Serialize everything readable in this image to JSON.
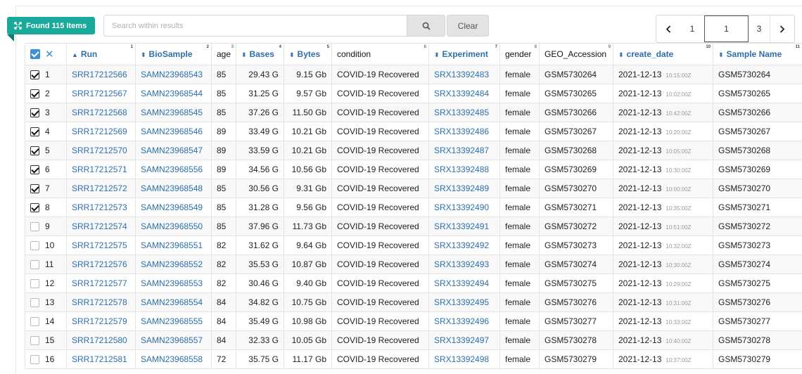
{
  "toolbar": {
    "found_label": "Found 115 Items",
    "search_placeholder": "Search within results",
    "search_value": "",
    "clear_label": "Clear"
  },
  "pager": {
    "pages": [
      "1",
      "1",
      "3"
    ],
    "prev_icon": "chevron-left-icon",
    "next_icon": "chevron-right-icon"
  },
  "columns": [
    {
      "label": "",
      "num": "",
      "sortable": false
    },
    {
      "label": "Run",
      "num": "1",
      "sortable": true,
      "sort": "asc"
    },
    {
      "label": "BioSample",
      "num": "2",
      "sortable": true
    },
    {
      "label": "age",
      "num": "3",
      "sortable": false
    },
    {
      "label": "Bases",
      "num": "4",
      "sortable": true
    },
    {
      "label": "Bytes",
      "num": "5",
      "sortable": true
    },
    {
      "label": "condition",
      "num": "6",
      "sortable": false
    },
    {
      "label": "Experiment",
      "num": "7",
      "sortable": true
    },
    {
      "label": "gender",
      "num": "8",
      "sortable": false
    },
    {
      "label": "GEO_Accession",
      "num": "9",
      "sortable": false
    },
    {
      "label": "create_date",
      "num": "10",
      "sortable": true
    },
    {
      "label": "Sample Name",
      "num": "11",
      "sortable": true
    }
  ],
  "rows": [
    {
      "checked": true,
      "n": "1",
      "run": "SRR17212566",
      "biosample": "SAMN23968543",
      "age": "85",
      "bases": "29.43 G",
      "bytes": "9.15 Gb",
      "condition": "COVID-19 Recovered",
      "experiment": "SRX13392483",
      "gender": "female",
      "geo": "GSM5730264",
      "date": "2021-12-13",
      "time": "10:15:00Z",
      "sample": "GSM5730264"
    },
    {
      "checked": true,
      "n": "2",
      "run": "SRR17212567",
      "biosample": "SAMN23968544",
      "age": "85",
      "bases": "31.25 G",
      "bytes": "9.57 Gb",
      "condition": "COVID-19 Recovered",
      "experiment": "SRX13392484",
      "gender": "female",
      "geo": "GSM5730265",
      "date": "2021-12-13",
      "time": "10:02:00Z",
      "sample": "GSM5730265"
    },
    {
      "checked": true,
      "n": "3",
      "run": "SRR17212568",
      "biosample": "SAMN23968545",
      "age": "85",
      "bases": "37.26 G",
      "bytes": "11.50 Gb",
      "condition": "COVID-19 Recovered",
      "experiment": "SRX13392485",
      "gender": "female",
      "geo": "GSM5730266",
      "date": "2021-12-13",
      "time": "10:42:00Z",
      "sample": "GSM5730266"
    },
    {
      "checked": true,
      "n": "4",
      "run": "SRR17212569",
      "biosample": "SAMN23968546",
      "age": "89",
      "bases": "33.49 G",
      "bytes": "10.21 Gb",
      "condition": "COVID-19 Recovered",
      "experiment": "SRX13392486",
      "gender": "female",
      "geo": "GSM5730267",
      "date": "2021-12-13",
      "time": "10:20:00Z",
      "sample": "GSM5730267"
    },
    {
      "checked": true,
      "n": "5",
      "run": "SRR17212570",
      "biosample": "SAMN23968547",
      "age": "89",
      "bases": "33.59 G",
      "bytes": "10.21 Gb",
      "condition": "COVID-19 Recovered",
      "experiment": "SRX13392487",
      "gender": "female",
      "geo": "GSM5730268",
      "date": "2021-12-13",
      "time": "10:05:00Z",
      "sample": "GSM5730268"
    },
    {
      "checked": true,
      "n": "6",
      "run": "SRR17212571",
      "biosample": "SAMN23968556",
      "age": "89",
      "bases": "34.56 G",
      "bytes": "10.56 Gb",
      "condition": "COVID-19 Recovered",
      "experiment": "SRX13392488",
      "gender": "female",
      "geo": "GSM5730269",
      "date": "2021-12-13",
      "time": "10:30:00Z",
      "sample": "GSM5730269"
    },
    {
      "checked": true,
      "n": "7",
      "run": "SRR17212572",
      "biosample": "SAMN23968548",
      "age": "85",
      "bases": "30.56 G",
      "bytes": "9.31 Gb",
      "condition": "COVID-19 Recovered",
      "experiment": "SRX13392489",
      "gender": "female",
      "geo": "GSM5730270",
      "date": "2021-12-13",
      "time": "10:00:00Z",
      "sample": "GSM5730270"
    },
    {
      "checked": true,
      "n": "8",
      "run": "SRR17212573",
      "biosample": "SAMN23968549",
      "age": "85",
      "bases": "31.28 G",
      "bytes": "9.56 Gb",
      "condition": "COVID-19 Recovered",
      "experiment": "SRX13392490",
      "gender": "female",
      "geo": "GSM5730271",
      "date": "2021-12-13",
      "time": "10:35:00Z",
      "sample": "GSM5730271"
    },
    {
      "checked": false,
      "n": "9",
      "run": "SRR17212574",
      "biosample": "SAMN23968550",
      "age": "85",
      "bases": "37.96 G",
      "bytes": "11.73 Gb",
      "condition": "COVID-19 Recovered",
      "experiment": "SRX13392491",
      "gender": "female",
      "geo": "GSM5730272",
      "date": "2021-12-13",
      "time": "10:51:00Z",
      "sample": "GSM5730272"
    },
    {
      "checked": false,
      "n": "10",
      "run": "SRR17212575",
      "biosample": "SAMN23968551",
      "age": "82",
      "bases": "31.62 G",
      "bytes": "9.64 Gb",
      "condition": "COVID-19 Recovered",
      "experiment": "SRX13392492",
      "gender": "female",
      "geo": "GSM5730273",
      "date": "2021-12-13",
      "time": "10:32:00Z",
      "sample": "GSM5730273"
    },
    {
      "checked": false,
      "n": "11",
      "run": "SRR17212576",
      "biosample": "SAMN23968552",
      "age": "82",
      "bases": "35.53 G",
      "bytes": "10.87 Gb",
      "condition": "COVID-19 Recovered",
      "experiment": "SRX13392493",
      "gender": "female",
      "geo": "GSM5730274",
      "date": "2021-12-13",
      "time": "10:30:00Z",
      "sample": "GSM5730274"
    },
    {
      "checked": false,
      "n": "12",
      "run": "SRR17212577",
      "biosample": "SAMN23968553",
      "age": "82",
      "bases": "30.46 G",
      "bytes": "9.40 Gb",
      "condition": "COVID-19 Recovered",
      "experiment": "SRX13392494",
      "gender": "female",
      "geo": "GSM5730275",
      "date": "2021-12-13",
      "time": "10:29:00Z",
      "sample": "GSM5730275"
    },
    {
      "checked": false,
      "n": "13",
      "run": "SRR17212578",
      "biosample": "SAMN23968554",
      "age": "84",
      "bases": "34.82 G",
      "bytes": "10.75 Gb",
      "condition": "COVID-19 Recovered",
      "experiment": "SRX13392495",
      "gender": "female",
      "geo": "GSM5730276",
      "date": "2021-12-13",
      "time": "10:31:00Z",
      "sample": "GSM5730276"
    },
    {
      "checked": false,
      "n": "14",
      "run": "SRR17212579",
      "biosample": "SAMN23968555",
      "age": "84",
      "bases": "35.49 G",
      "bytes": "10.98 Gb",
      "condition": "COVID-19 Recovered",
      "experiment": "SRX13392496",
      "gender": "female",
      "geo": "GSM5730277",
      "date": "2021-12-13",
      "time": "10:33:00Z",
      "sample": "GSM5730277"
    },
    {
      "checked": false,
      "n": "15",
      "run": "SRR17212580",
      "biosample": "SAMN23968557",
      "age": "84",
      "bases": "32.33 G",
      "bytes": "10.05 Gb",
      "condition": "COVID-19 Recovered",
      "experiment": "SRX13392497",
      "gender": "female",
      "geo": "GSM5730278",
      "date": "2021-12-13",
      "time": "10:40:00Z",
      "sample": "GSM5730278"
    },
    {
      "checked": false,
      "n": "16",
      "run": "SRR17212581",
      "biosample": "SAMN23968558",
      "age": "72",
      "bases": "35.75 G",
      "bytes": "11.17 Gb",
      "condition": "COVID-19 Recovered",
      "experiment": "SRX13392498",
      "gender": "female",
      "geo": "GSM5730279",
      "date": "2021-12-13",
      "time": "10:37:00Z",
      "sample": "GSM5730279"
    }
  ],
  "colors": {
    "accent": "#17a99a",
    "link": "#2d6fae",
    "select": "#3d8fd8"
  }
}
